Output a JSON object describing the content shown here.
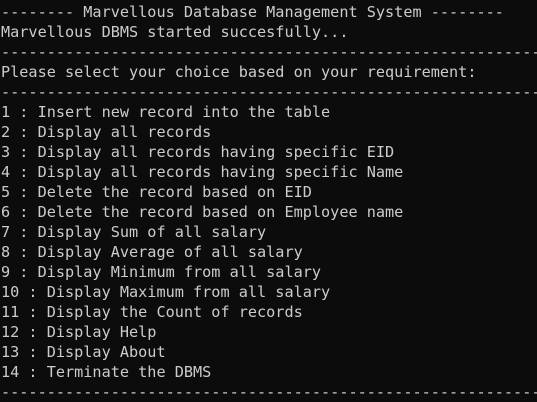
{
  "window": {
    "header_line": "-------- Marvellous Database Management System --------",
    "status_line": "Marvellous DBMS started succesfully...",
    "separator": "-----------------------------------------------------------------",
    "prompt_line": "Please select your choice based on your requirement:"
  },
  "menu": {
    "items": [
      "1 : Insert new record into the table",
      "2 : Display all records",
      "3 : Display all records having specific EID",
      "4 : Display all records having specific Name",
      "5 : Delete the record based on EID",
      "6 : Delete the record based on Employee name",
      "7 : Display Sum of all salary",
      "8 : Display Average of all salary",
      "9 : Display Minimum from all salary",
      "10 : Display Maximum from all salary",
      "11 : Display the Count of records",
      "12 : Display Help",
      "13 : Display About",
      "14 : Terminate the DBMS"
    ]
  },
  "colors": {
    "background": "#0c0c0c",
    "text": "#cccccc"
  }
}
